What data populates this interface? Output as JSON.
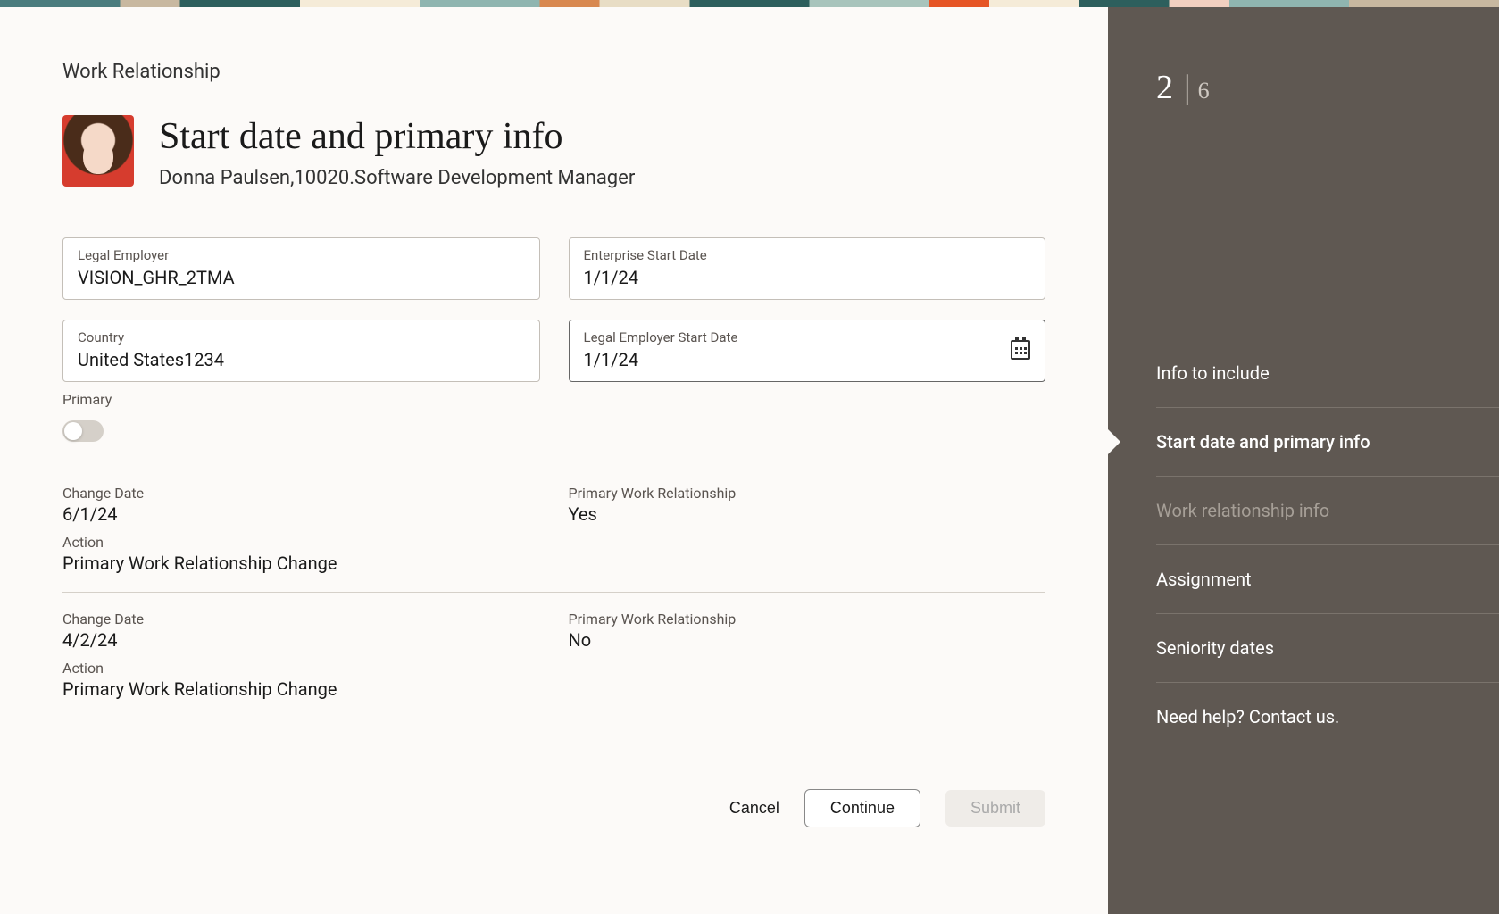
{
  "breadcrumb": "Work Relationship",
  "header": {
    "title": "Start date and primary info",
    "subtitle": "Donna Paulsen,10020.Software Development Manager"
  },
  "fields": {
    "legal_employer": {
      "label": "Legal Employer",
      "value": "VISION_GHR_2TMA"
    },
    "enterprise_start_date": {
      "label": "Enterprise Start Date",
      "value": "1/1/24"
    },
    "country": {
      "label": "Country",
      "value": "United States1234"
    },
    "legal_employer_start_date": {
      "label": "Legal Employer Start Date",
      "value": "1/1/24"
    }
  },
  "primary": {
    "label": "Primary",
    "on": false
  },
  "history": [
    {
      "change_date": {
        "label": "Change Date",
        "value": "6/1/24"
      },
      "primary_rel": {
        "label": "Primary Work Relationship",
        "value": "Yes"
      },
      "action": {
        "label": "Action",
        "value": "Primary Work Relationship Change"
      }
    },
    {
      "change_date": {
        "label": "Change Date",
        "value": "4/2/24"
      },
      "primary_rel": {
        "label": "Primary Work Relationship",
        "value": "No"
      },
      "action": {
        "label": "Action",
        "value": "Primary Work Relationship Change"
      }
    }
  ],
  "actions": {
    "cancel": "Cancel",
    "continue": "Continue",
    "submit": "Submit"
  },
  "wizard": {
    "current": "2",
    "total": "6",
    "steps": [
      {
        "label": "Info to include",
        "state": "default"
      },
      {
        "label": "Start date and primary info",
        "state": "active"
      },
      {
        "label": "Work relationship info",
        "state": "muted"
      },
      {
        "label": "Assignment",
        "state": "default"
      },
      {
        "label": "Seniority dates",
        "state": "default"
      },
      {
        "label": "Need help? Contact us.",
        "state": "default"
      }
    ]
  }
}
